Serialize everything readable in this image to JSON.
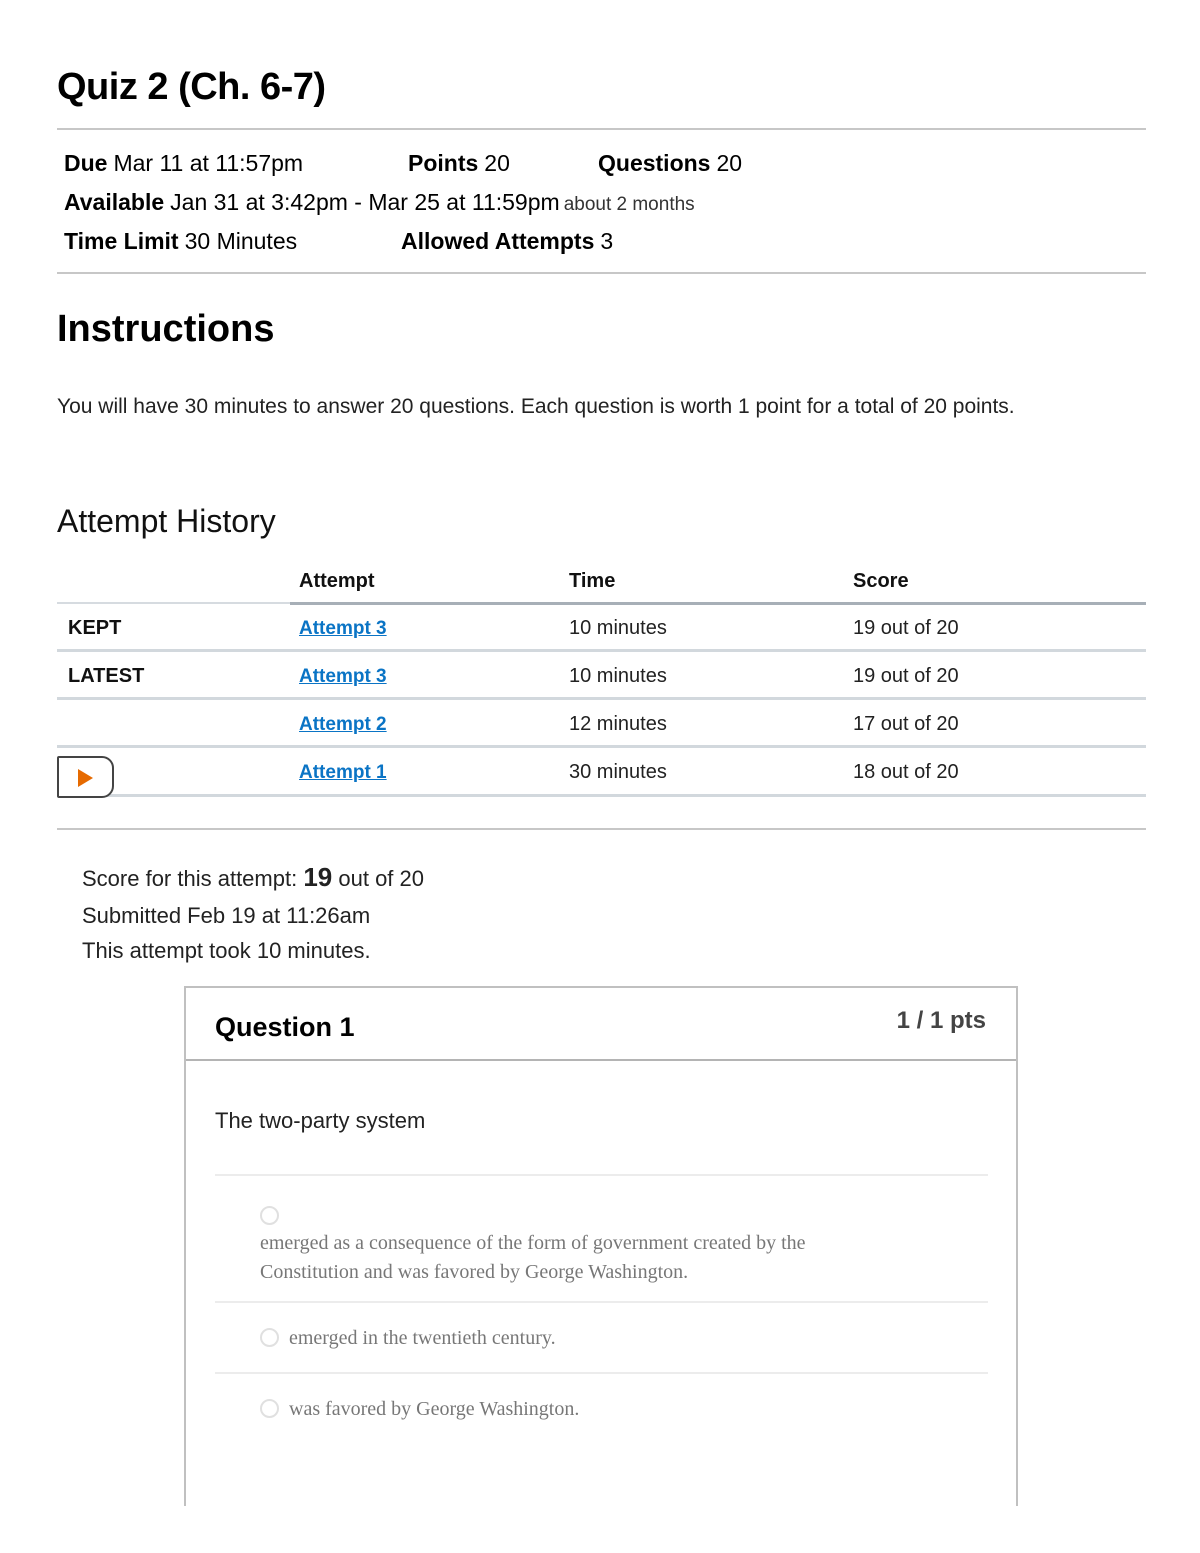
{
  "page": {
    "title": "Quiz 2 (Ch. 6-7)"
  },
  "meta": {
    "due_label": "Due",
    "due_value": "Mar 11 at 11:57pm",
    "points_label": "Points",
    "points_value": "20",
    "questions_label": "Questions",
    "questions_value": "20",
    "available_label": "Available",
    "available_value": "Jan 31 at 3:42pm - Mar 25 at 11:59pm",
    "available_duration": "about 2 months",
    "time_limit_label": "Time Limit",
    "time_limit_value": "30 Minutes",
    "allowed_attempts_label": "Allowed Attempts",
    "allowed_attempts_value": "3"
  },
  "instructions": {
    "heading": "Instructions",
    "text": "You will have 30 minutes to answer 20 questions. Each question is worth 1 point for a total of 20 points."
  },
  "attempt_history": {
    "heading": "Attempt History",
    "columns": [
      "",
      "Attempt",
      "Time",
      "Score"
    ],
    "rows": [
      {
        "status": "KEPT",
        "attempt": "Attempt 3",
        "time": "10 minutes",
        "score": "19 out of 20"
      },
      {
        "status": "LATEST",
        "attempt": "Attempt 3",
        "time": "10 minutes",
        "score": "19 out of 20"
      },
      {
        "status": "",
        "attempt": "Attempt 2",
        "time": "12 minutes",
        "score": "17 out of 20"
      },
      {
        "status": "",
        "attempt": "Attempt 1",
        "time": "30 minutes",
        "score": "18 out of 20"
      }
    ],
    "current_row_icon": "play-arrow-icon",
    "accent_color": "#e66a00",
    "link_color": "#0a74c5"
  },
  "summary": {
    "score_prefix": "Score for this attempt:",
    "score_value": "19",
    "score_suffix": "out of 20",
    "submitted": "Submitted Feb 19 at 11:26am",
    "duration": "This attempt took 10 minutes."
  },
  "question": {
    "title": "Question 1",
    "points": "1 / 1 pts",
    "text": "The two-party system",
    "answers": [
      {
        "text": "emerged as a consequence of the form of government created by the Constitution and was favored by George Washington.",
        "line1": "emerged as a consequence of the form of government created by the",
        "line2": "Constitution and was favored by George Washington.",
        "selected": false
      },
      {
        "text": "emerged in the twentieth century.",
        "selected": false
      },
      {
        "text": "was favored by George Washington.",
        "selected": false
      }
    ]
  }
}
